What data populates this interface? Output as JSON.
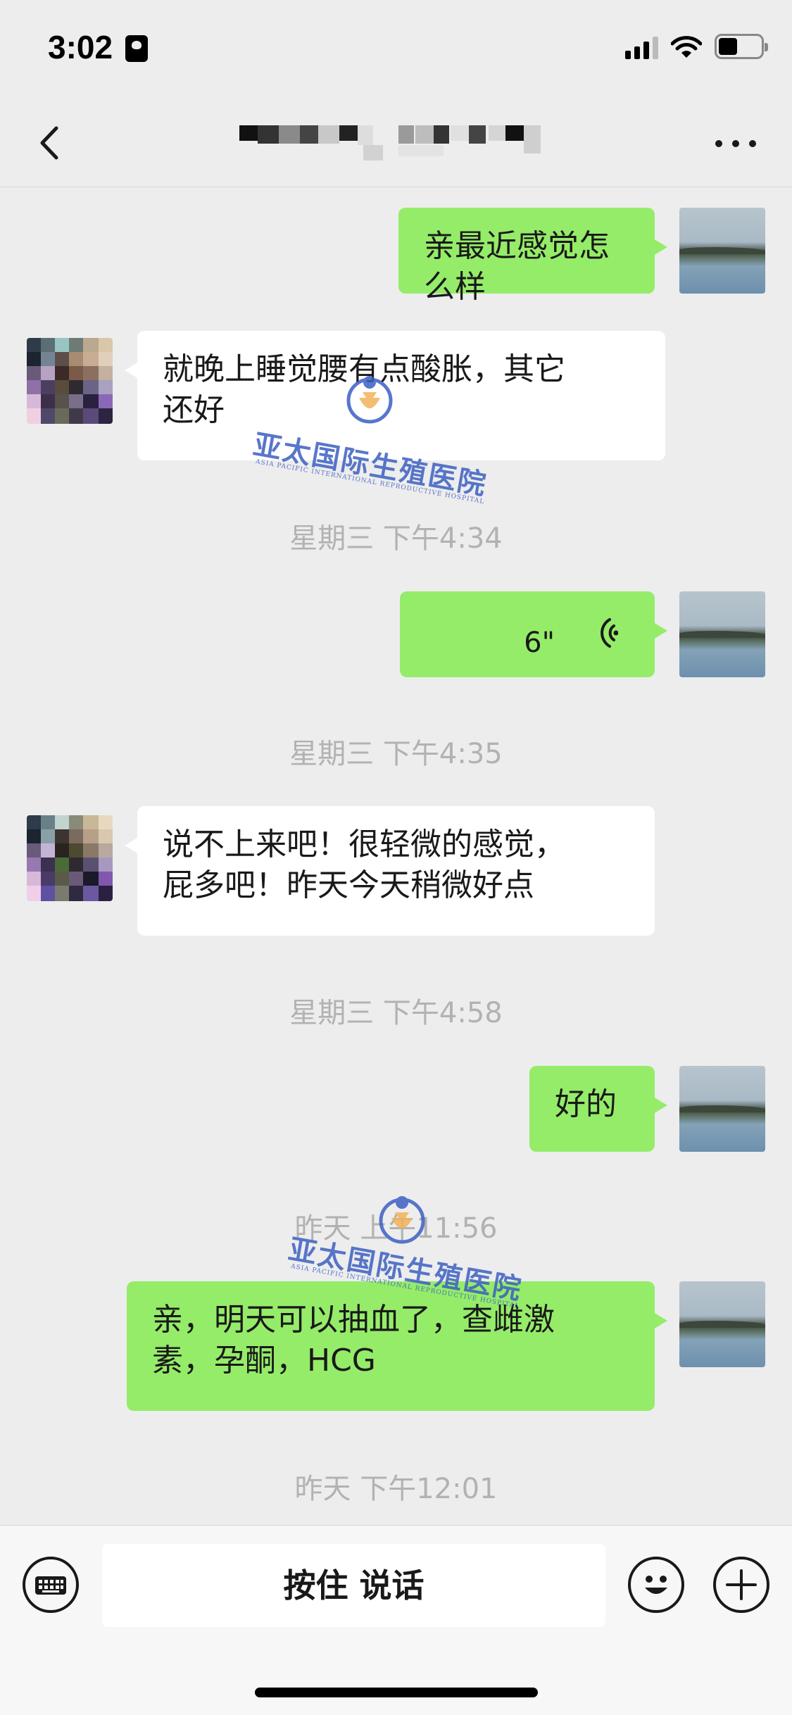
{
  "status_bar": {
    "time": "3:02"
  },
  "header": {
    "title": "",
    "back_icon": "chevron-left-icon",
    "more_icon": "more-icon"
  },
  "messages": [
    {
      "side": "mine",
      "type": "text",
      "text": "亲最近感觉怎么样"
    },
    {
      "side": "theirs",
      "type": "text",
      "lines": [
        "就晚上睡觉腰有点酸胀，其它",
        "还好"
      ]
    },
    {
      "type": "timestamp",
      "text": "星期三 下午4:34"
    },
    {
      "side": "mine",
      "type": "voice",
      "duration": "6\""
    },
    {
      "type": "timestamp",
      "text": "星期三 下午4:35"
    },
    {
      "side": "theirs",
      "type": "text",
      "lines": [
        "说不上来吧！很轻微的感觉，",
        "屁多吧！昨天今天稍微好点"
      ]
    },
    {
      "type": "timestamp",
      "text": "星期三 下午4:58"
    },
    {
      "side": "mine",
      "type": "text",
      "text": "好的"
    },
    {
      "type": "timestamp",
      "text": "昨天 上午11:56"
    },
    {
      "side": "mine",
      "type": "text",
      "lines": [
        "亲，明天可以抽血了，查雌激",
        "素，孕酮，HCG"
      ]
    },
    {
      "type": "timestamp",
      "text": "昨天 下午12:01"
    }
  ],
  "watermark": {
    "name": "亚太国际生殖医院",
    "english": "ASIA PACIFIC INTERNATIONAL REPRODUCTIVE HOSPITAL"
  },
  "input_bar": {
    "hold_to_talk": "按住 说话",
    "keyboard_icon": "keyboard-icon",
    "emoji_icon": "emoji-icon",
    "add_icon": "plus-icon"
  },
  "colors": {
    "background": "#ededed",
    "bubble_mine": "#95ec69",
    "bubble_theirs": "#ffffff",
    "timestamp": "#b2b2b2",
    "watermark": "#3c5fc2"
  }
}
